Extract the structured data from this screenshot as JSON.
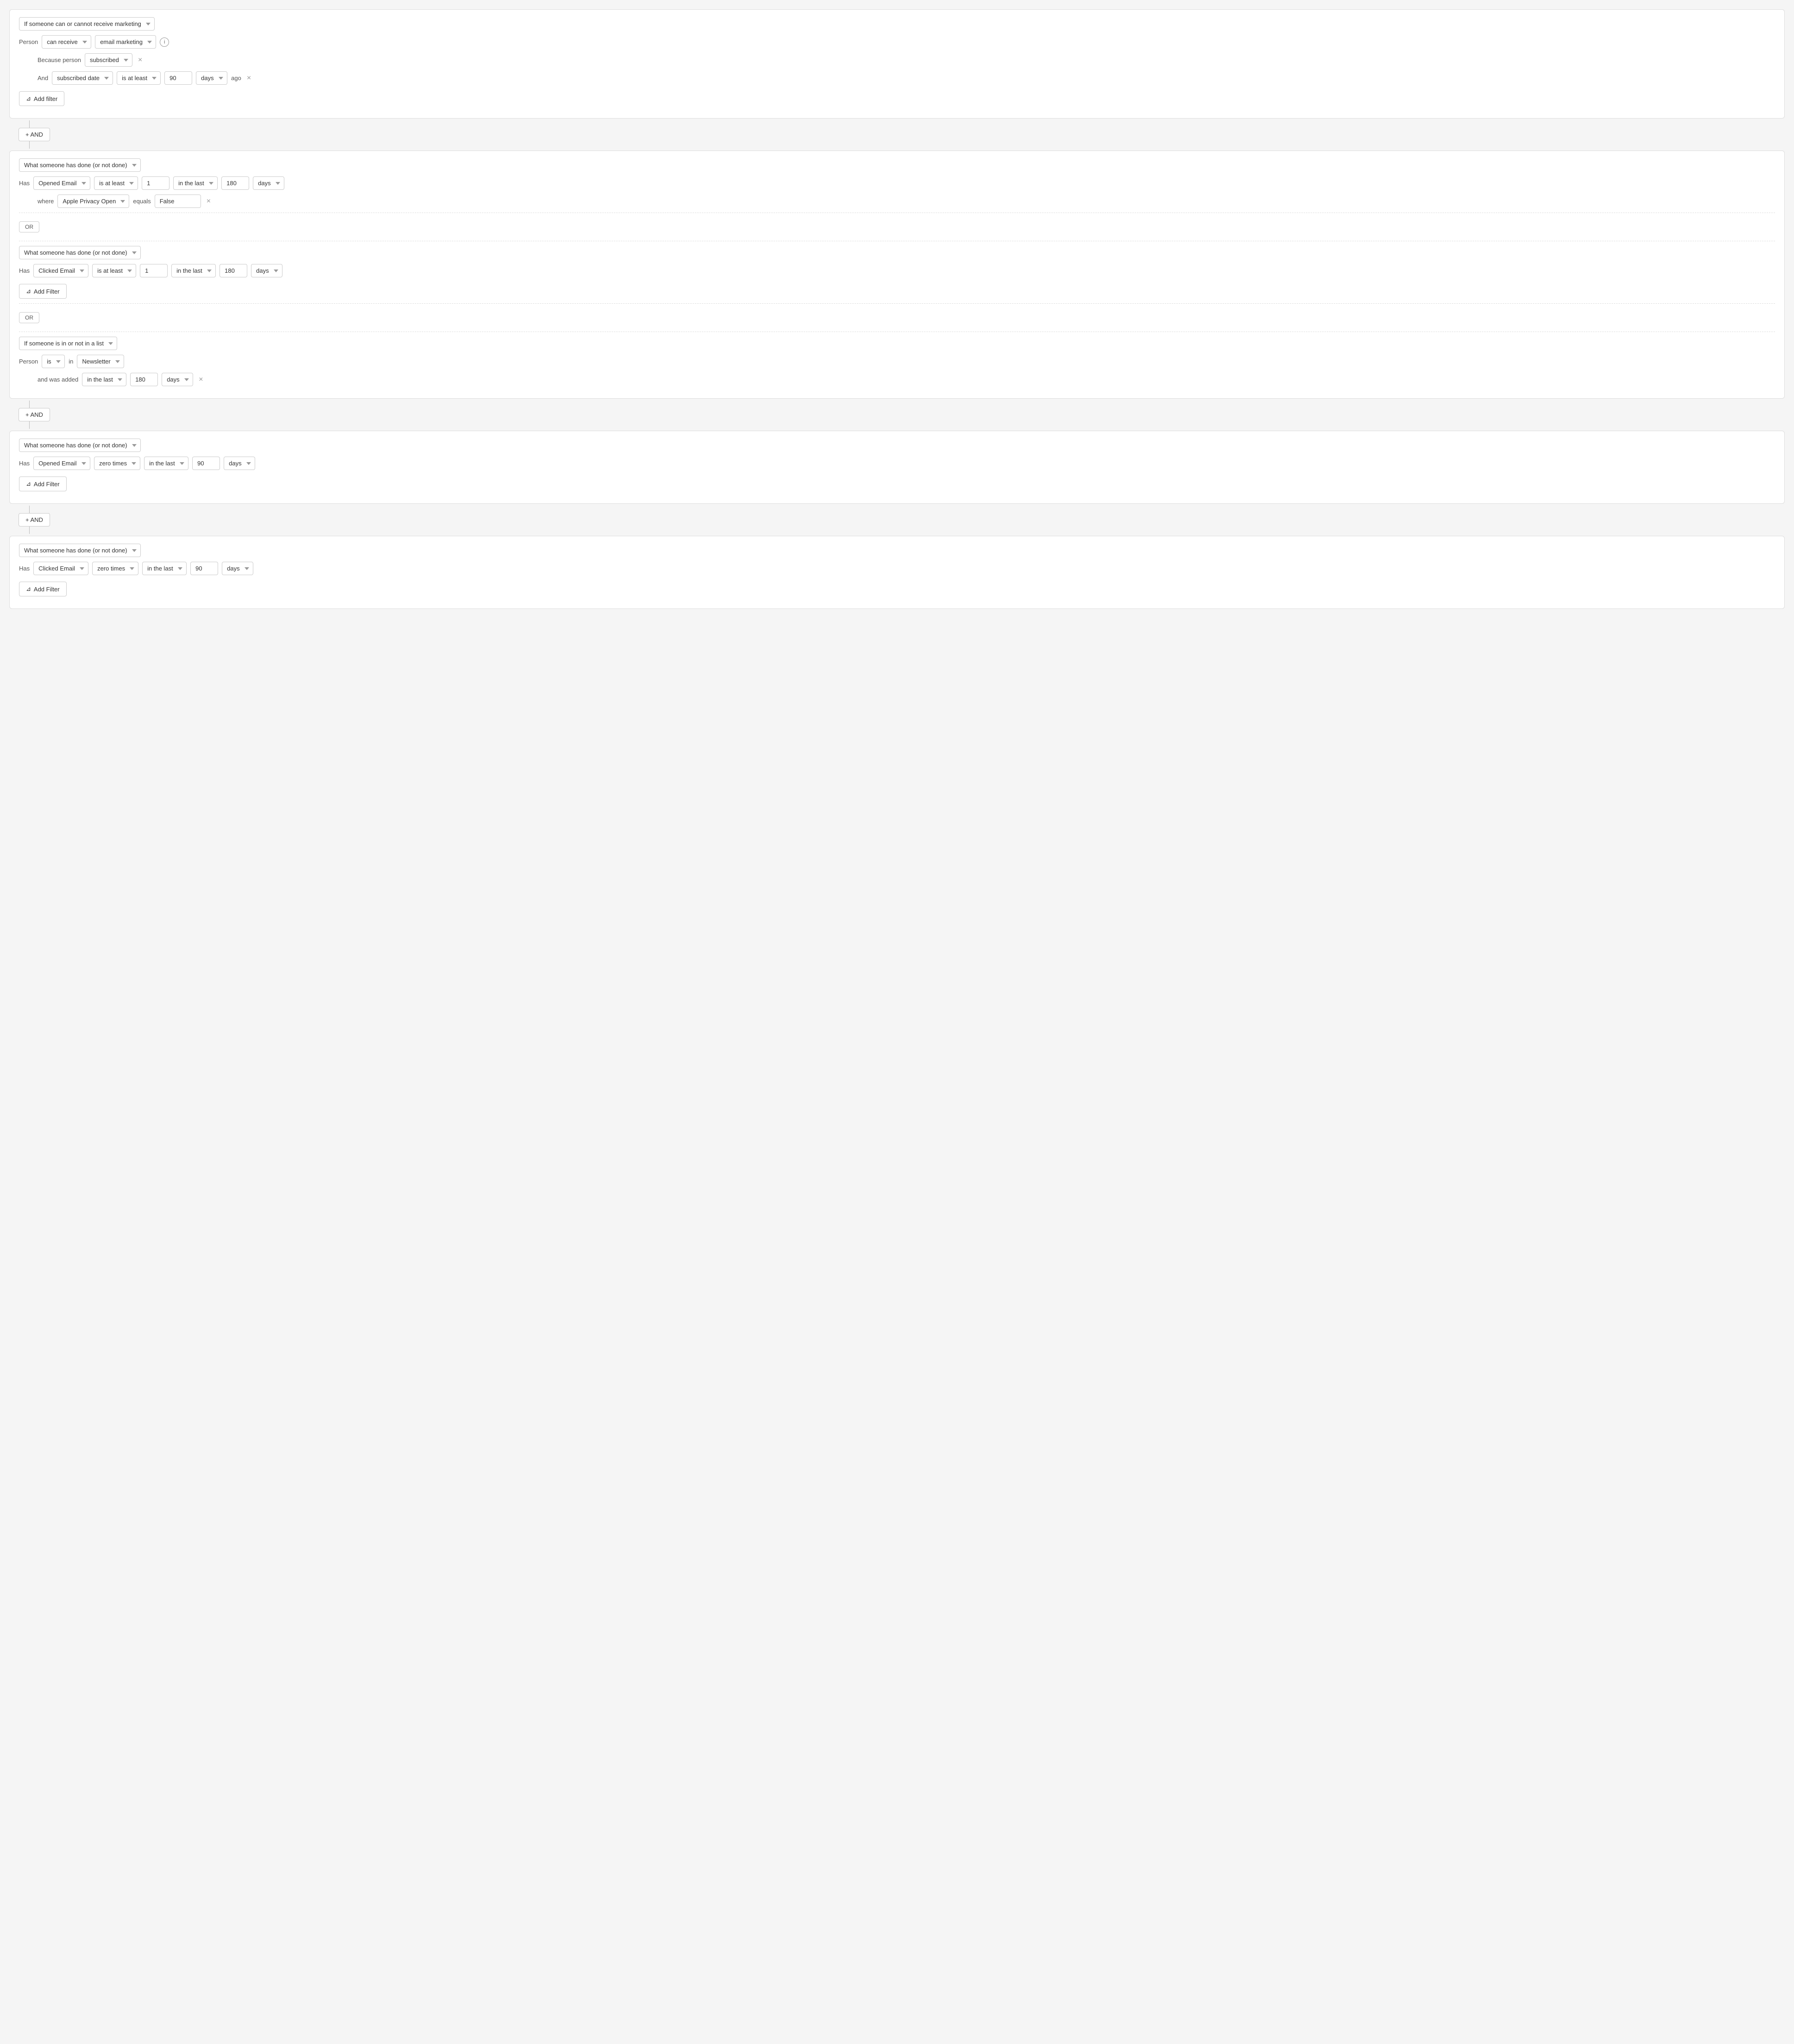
{
  "blocks": [
    {
      "id": "block1",
      "type": "marketing",
      "main_select": "If someone can or cannot receive marketing",
      "rows": [
        {
          "type": "person",
          "label": "Person",
          "selects": [
            "can receive",
            "email marketing"
          ],
          "info": true
        },
        {
          "type": "because",
          "label": "Because person",
          "select": "subscribed",
          "has_close": true
        },
        {
          "type": "and_filter",
          "label": "And",
          "selects": [
            "subscribed date",
            "is at least"
          ],
          "value": "90",
          "unit": "days",
          "suffix": "ago",
          "has_close": true
        }
      ],
      "add_filter_label": "Add filter"
    },
    {
      "id": "block2",
      "type": "group",
      "sub_blocks": [
        {
          "type": "has_done",
          "main_select": "What someone has done (or not done)",
          "has_label": "Has",
          "event": "Opened Email",
          "condition": "is at least",
          "value": "1",
          "time_condition": "in the last",
          "time_value": "180",
          "time_unit": "days",
          "where_label": "where",
          "where_select": "Apple Privacy Open",
          "where_equals": "equals",
          "where_value": "False",
          "has_where": true
        },
        {
          "type": "or"
        },
        {
          "type": "has_done",
          "main_select": "What someone has done (or not done)",
          "has_label": "Has",
          "event": "Clicked Email",
          "condition": "is at least",
          "value": "1",
          "time_condition": "in the last",
          "time_value": "180",
          "time_unit": "days",
          "has_where": false,
          "add_filter_label": "Add Filter"
        },
        {
          "type": "or"
        },
        {
          "type": "list",
          "main_select": "If someone is in or not in a list",
          "person_label": "Person",
          "person_select": "is",
          "in_label": "in",
          "list_select": "Newsletter",
          "added_label": "and was added",
          "added_select": "in the last",
          "added_value": "180",
          "added_unit": "days",
          "has_close": true
        }
      ]
    },
    {
      "id": "block3",
      "type": "has_done_single",
      "main_select": "What someone has done (or not done)",
      "has_label": "Has",
      "event": "Opened Email",
      "condition": "zero times",
      "time_condition": "in the last",
      "time_value": "90",
      "time_unit": "days",
      "add_filter_label": "Add Filter"
    },
    {
      "id": "block4",
      "type": "has_done_single",
      "main_select": "What someone has done (or not done)",
      "has_label": "Has",
      "event": "Clicked Email",
      "condition": "zero times",
      "time_condition": "in the last",
      "time_value": "90",
      "time_unit": "days",
      "add_filter_label": "Add Filter"
    }
  ],
  "and_label": "+ AND",
  "or_label": "OR",
  "add_filter_label": "Add filter",
  "icons": {
    "filter": "⊿",
    "info": "i",
    "close": "×",
    "email": "✉",
    "dropdown": "▾"
  }
}
